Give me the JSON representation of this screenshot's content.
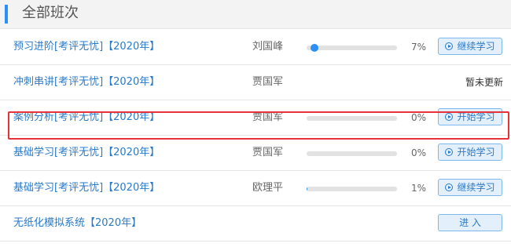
{
  "header": {
    "title": "全部班次"
  },
  "courses": [
    {
      "name": "预习进阶[考评无忧]【2020年】",
      "teacher": "刘国峰",
      "progress": 7,
      "pct_label": "7%",
      "button": "继续学习"
    },
    {
      "name": "冲刺串讲[考评无忧]【2020年】",
      "teacher": "贾国军",
      "note": "暂未更新"
    },
    {
      "name": "案例分析[考评无忧]【2020年】",
      "teacher": "贾国军",
      "progress": 0,
      "pct_label": "0%",
      "button": "开始学习"
    },
    {
      "name": "基础学习[考评无忧]【2020年】",
      "teacher": "贾国军",
      "progress": 0,
      "pct_label": "0%",
      "button": "开始学习"
    },
    {
      "name": "基础学习[考评无忧]【2020年】",
      "teacher": "欧理平",
      "progress": 1,
      "pct_label": "1%",
      "button": "继续学习"
    },
    {
      "name": "无纸化模拟系统【2020年】",
      "button": "进 入"
    }
  ],
  "colors": {
    "accent": "#2a8ff7",
    "highlight": "#e8323a"
  }
}
